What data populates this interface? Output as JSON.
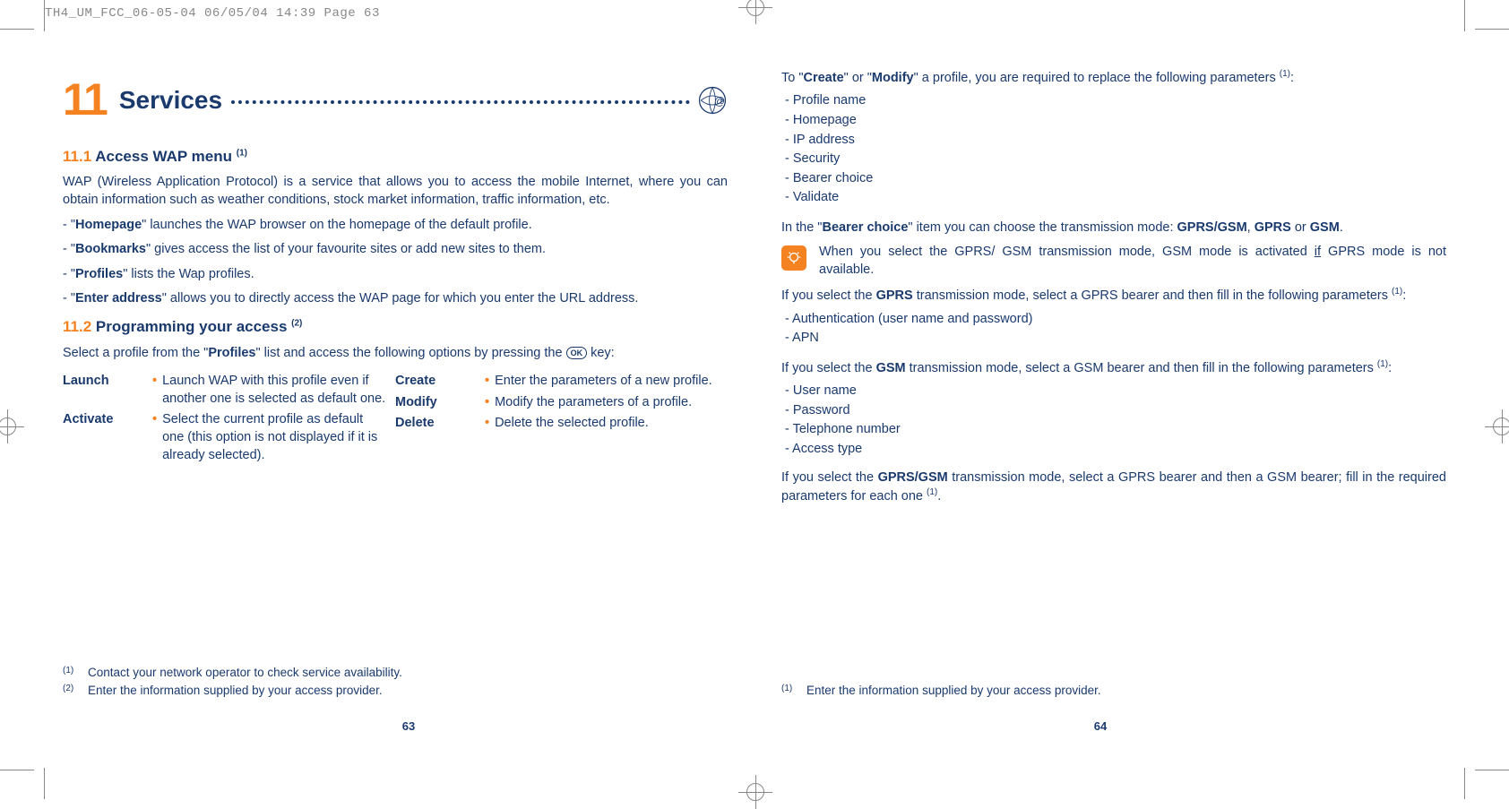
{
  "header": "TH4_UM_FCC_06-05-04  06/05/04  14:39  Page 63",
  "chapter": {
    "num": "11",
    "title": "Services"
  },
  "s111": {
    "num": "11.1",
    "title": "Access WAP menu",
    "sup": "(1)",
    "intro": "WAP (Wireless Application Protocol) is a service that allows you to access the mobile Internet, where you can obtain information such as weather conditions, stock market information, traffic information, etc.",
    "items": [
      {
        "term": "Homepage",
        "rest": "\" launches the WAP browser on the homepage of the default profile."
      },
      {
        "term": "Bookmarks",
        "rest": "\" gives access the list of your favourite sites or add new sites to them."
      },
      {
        "term": "Profiles",
        "rest": "\" lists the Wap profiles."
      },
      {
        "term": "Enter address",
        "rest": "\" allows you to directly access the WAP page for which you enter the URL address."
      }
    ]
  },
  "s112": {
    "num": "11.2",
    "title": "Programming your access",
    "sup": "(2)",
    "intro_a": "Select a profile from the \"",
    "intro_bold": "Profiles",
    "intro_b": "\" list and access the following options by pressing the ",
    "intro_c": " key:",
    "ok": "OK",
    "left": [
      {
        "term": "Launch",
        "desc": "Launch WAP with this profile even if another one is selected as default one."
      },
      {
        "term": "Activate",
        "desc": "Select the current profile as default one (this option is not displayed if it is already selected)."
      }
    ],
    "right": [
      {
        "term": "Create",
        "desc": "Enter the parameters of a new profile."
      },
      {
        "term": "Modify",
        "desc": "Modify the parameters of a profile."
      },
      {
        "term": "Delete",
        "desc": "Delete the selected profile."
      }
    ]
  },
  "right_page": {
    "p1_a": "To \"",
    "p1_b1": "Create",
    "p1_b": "\" or \"",
    "p1_b2": "Modify",
    "p1_c": "\" a profile, you are required to replace the following parameters ",
    "p1_sup": "(1)",
    "params1": [
      "Profile name",
      "Homepage",
      "IP address",
      "Security",
      "Bearer choice",
      "Validate"
    ],
    "p2_a": "In the \"",
    "p2_bold": "Bearer choice",
    "p2_b": "\" item you can choose the transmission mode: ",
    "p2_m1": "GPRS/GSM",
    "p2_m2": "GPRS",
    "p2_m3": "GSM",
    "tip": "When you select the GPRS/ GSM transmission mode, GSM mode is activated ",
    "tip_u": "if",
    "tip_b": " GPRS mode is not available.",
    "p3_a": "If you select the ",
    "p3_bold": "GPRS",
    "p3_b": " transmission mode, select a GPRS bearer and then fill in the following parameters ",
    "p3_sup": "(1)",
    "params2": [
      "Authentication (user name and password)",
      "APN"
    ],
    "p4_a": "If you select the ",
    "p4_bold": "GSM",
    "p4_b": " transmission mode, select a GSM bearer and then fill in the following parameters ",
    "p4_sup": "(1)",
    "params3": [
      "User name",
      "Password",
      "Telephone number",
      "Access type"
    ],
    "p5_a": "If you select the ",
    "p5_bold": "GPRS/GSM",
    "p5_b": " transmission mode, select a GPRS bearer and then a GSM bearer; fill in the required parameters for each one ",
    "p5_sup": "(1)"
  },
  "footnotes_left": [
    {
      "num": "(1)",
      "text": "Contact your network operator to check service availability."
    },
    {
      "num": "(2)",
      "text": "Enter the information supplied by your access provider."
    }
  ],
  "footnotes_right": [
    {
      "num": "(1)",
      "text": "Enter the information supplied by your access provider."
    }
  ],
  "pagenum_left": "63",
  "pagenum_right": "64"
}
